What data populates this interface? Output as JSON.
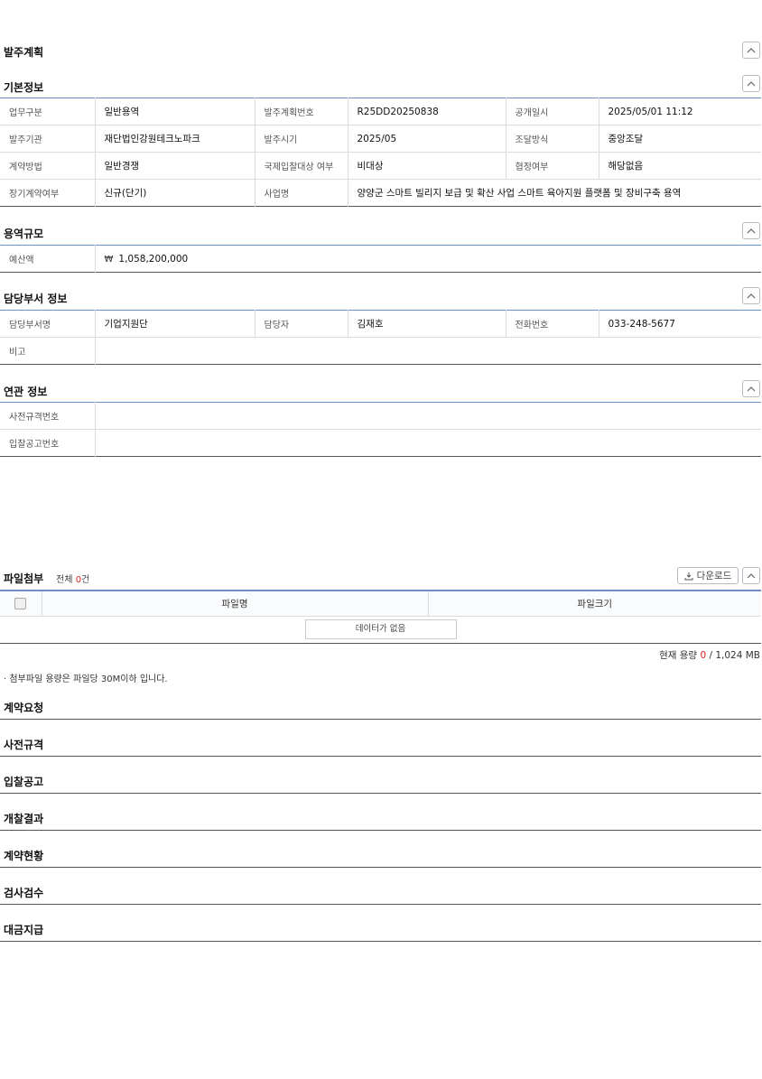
{
  "page_title": "발주계획",
  "basic": {
    "title": "기본정보",
    "rows": [
      [
        {
          "l": "업무구분",
          "v": "일반용역"
        },
        {
          "l": "발주계획번호",
          "v": "R25DD20250838"
        },
        {
          "l": "공개일시",
          "v": "2025/05/01 11:12"
        }
      ],
      [
        {
          "l": "발주기관",
          "v": "재단법인강원테크노파크"
        },
        {
          "l": "발주시기",
          "v": "2025/05"
        },
        {
          "l": "조달방식",
          "v": "중앙조달"
        }
      ],
      [
        {
          "l": "계약방법",
          "v": "일반경쟁"
        },
        {
          "l": "국제입찰대상 여부",
          "v": "비대상"
        },
        {
          "l": "협정여부",
          "v": "해당없음"
        }
      ]
    ],
    "row4": {
      "l1": "장기계약여부",
      "v1": "신규(단기)",
      "l2": "사업명",
      "v2": "양양군 스마트 빌리지 보급 및 확산 사업 스마트 육아지원 플랫폼 및 장비구축 용역"
    }
  },
  "scale": {
    "title": "용역규모",
    "budget_label": "예산액",
    "currency": "₩",
    "budget_value": "1,058,200,000"
  },
  "dept": {
    "title": "담당부서 정보",
    "row1": {
      "l1": "담당부서명",
      "v1": "기업지원단",
      "l2": "담당자",
      "v2": "김재호",
      "l3": "전화번호",
      "v3": "033-248-5677"
    },
    "note_label": "비고",
    "note_value": ""
  },
  "related": {
    "title": "연관 정보",
    "row1_label": "사전규격번호",
    "row1_value": "",
    "row2_label": "입찰공고번호",
    "row2_value": ""
  },
  "files": {
    "title": "파일첨부",
    "count_prefix": "전체 ",
    "count": "0",
    "count_suffix": "건",
    "download_label": "다운로드",
    "col_name": "파일명",
    "col_size": "파일크기",
    "no_data": "데이터가 없음",
    "usage_prefix": "현재 용량 ",
    "usage_value": "0",
    "usage_suffix": " / 1,024 MB",
    "note": "· 첨부파일 용량은 파일당 30M이하 입니다."
  },
  "collapsed_sections": [
    "계약요청",
    "사전규격",
    "입찰공고",
    "개찰결과",
    "계약현황",
    "검사검수",
    "대금지급"
  ]
}
